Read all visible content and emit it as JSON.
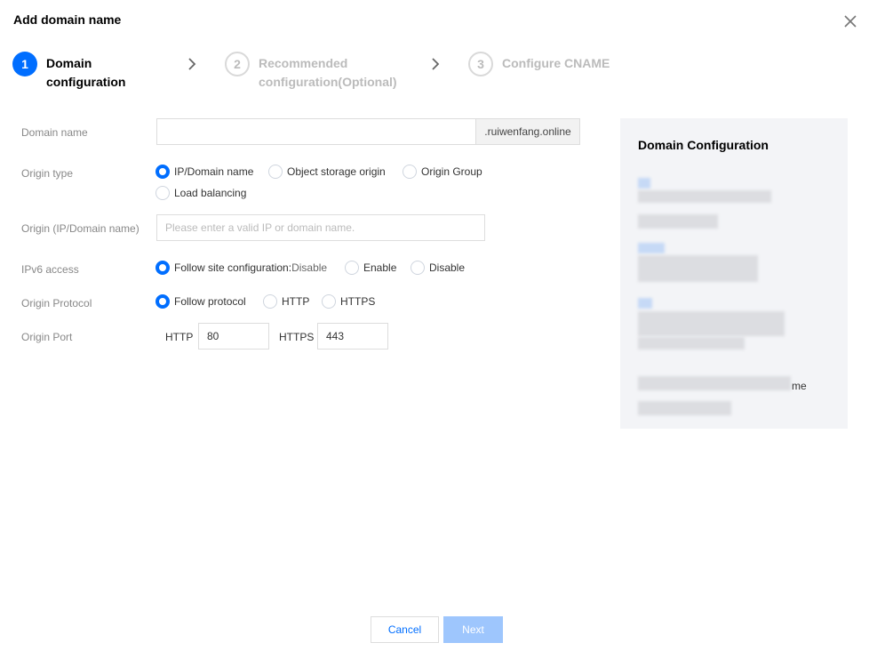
{
  "dialog": {
    "title": "Add domain name"
  },
  "steps": [
    {
      "number": "1",
      "line1": "Domain",
      "line2": "configuration"
    },
    {
      "number": "2",
      "line1": "Recommended",
      "line2": "configuration(Optional)"
    },
    {
      "number": "3",
      "line1": "Configure CNAME",
      "line2": ""
    }
  ],
  "form": {
    "domain_name": {
      "label": "Domain name",
      "value": "",
      "suffix": ".ruiwenfang.online"
    },
    "origin_type": {
      "label": "Origin type",
      "options": [
        "IP/Domain name",
        "Object storage origin",
        "Origin Group",
        "Load balancing"
      ],
      "selected": "IP/Domain name"
    },
    "origin": {
      "label": "Origin (IP/Domain name)",
      "placeholder": "Please enter a valid IP or domain name."
    },
    "ipv6": {
      "label": "IPv6 access",
      "options": [
        {
          "label": "Follow site configuration:",
          "sub": " Disable"
        },
        {
          "label": "Enable",
          "sub": ""
        },
        {
          "label": "Disable",
          "sub": ""
        }
      ],
      "selected": "Follow site configuration:"
    },
    "origin_protocol": {
      "label": "Origin Protocol",
      "options": [
        "Follow protocol",
        "HTTP",
        "HTTPS"
      ],
      "selected": "Follow protocol"
    },
    "origin_port": {
      "label": "Origin Port",
      "http_label": "HTTP",
      "http_value": "80",
      "https_label": "HTTPS",
      "https_value": "443"
    }
  },
  "side_panel": {
    "title": "Domain Configuration",
    "visible_fragment": "me"
  },
  "footer": {
    "cancel_label": "Cancel",
    "next_label": "Next"
  },
  "colors": {
    "accent": "#006eff",
    "next_disabled": "#9ec6fd",
    "panel_bg": "#f3f4f7"
  }
}
